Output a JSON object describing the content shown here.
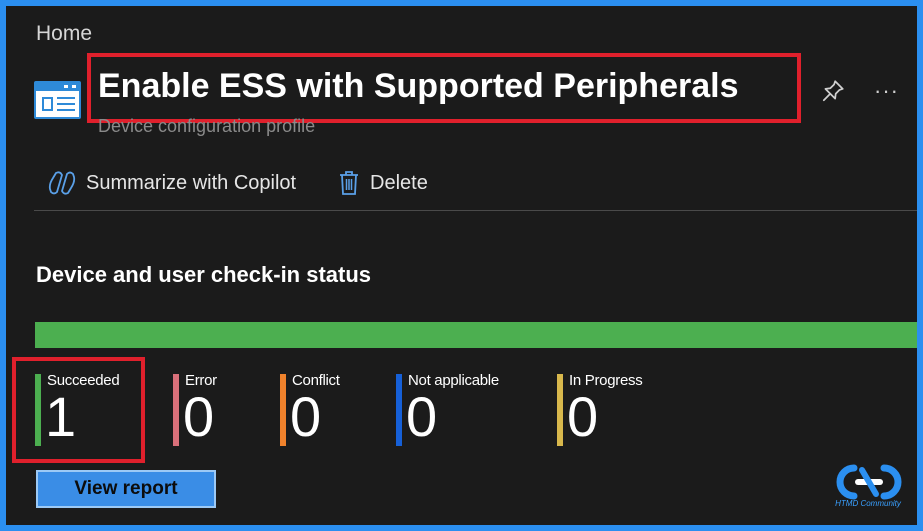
{
  "breadcrumb": "Home",
  "header": {
    "title": "Enable ESS with Supported Peripherals",
    "subtitle": "Device configuration profile"
  },
  "commands": {
    "copilot": "Summarize with Copilot",
    "delete": "Delete"
  },
  "status": {
    "title": "Device and user check-in status",
    "progress_fraction": 1.0,
    "items": [
      {
        "label": "Succeeded",
        "value": "1",
        "color": "#4caf50"
      },
      {
        "label": "Error",
        "value": "0",
        "color": "#d9707a"
      },
      {
        "label": "Conflict",
        "value": "0",
        "color": "#f0822c"
      },
      {
        "label": "Not applicable",
        "value": "0",
        "color": "#1660d8"
      },
      {
        "label": "In Progress",
        "value": "0",
        "color": "#d8b84c"
      }
    ]
  },
  "view_report": "View report",
  "watermark": "HTMD Community",
  "colors": {
    "accent": "#3a8de6",
    "highlight": "#e0202c",
    "success": "#4caf50"
  }
}
